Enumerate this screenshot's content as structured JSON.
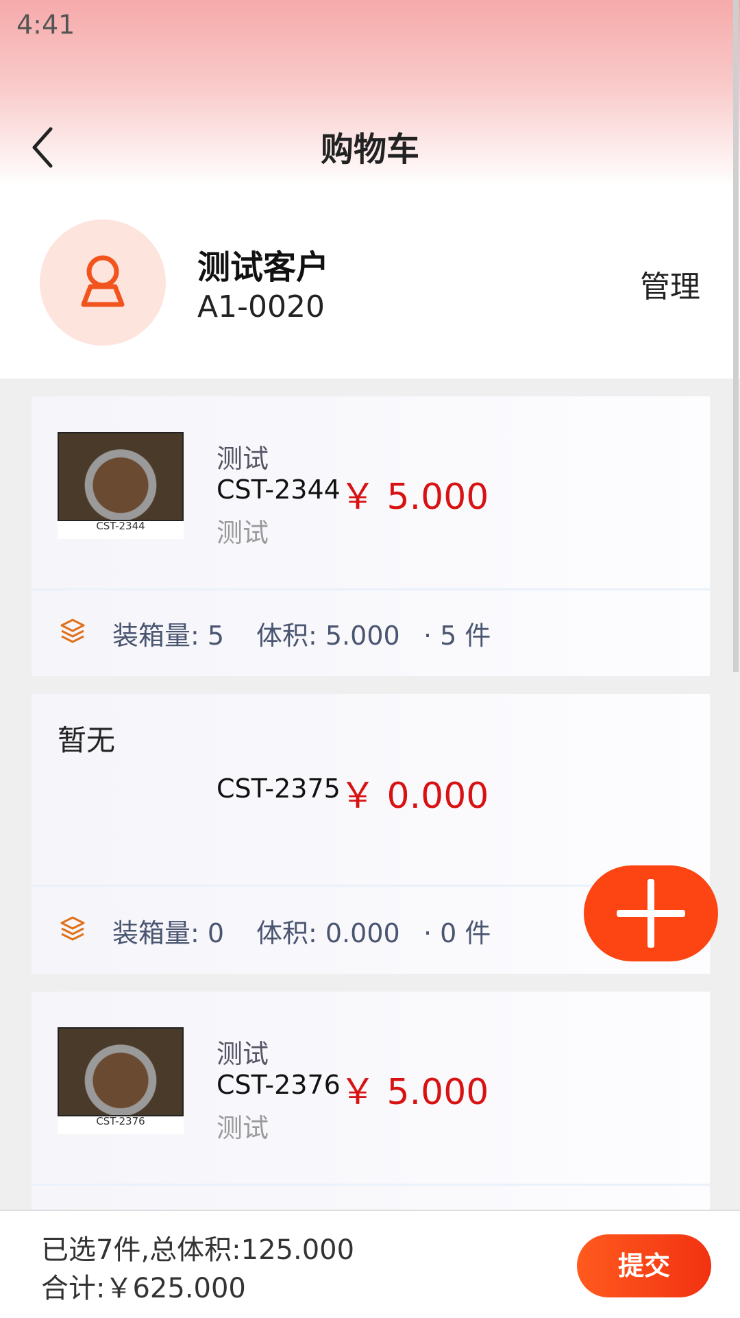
{
  "status_bar": {
    "time": "4:41"
  },
  "header": {
    "title": "购物车"
  },
  "customer": {
    "name": "测试客户",
    "code": "A1-0020",
    "manage_label": "管理"
  },
  "cart_items": [
    {
      "image_caption": "CST-2344",
      "name": "测试",
      "code": "CST-2344",
      "price": "￥ 5.000",
      "description": "测试",
      "box_qty": "装箱量: 5",
      "volume": "体积: 5.000",
      "count": "· 5 件"
    },
    {
      "no_image_label": "暂无",
      "code": "CST-2375",
      "price": "￥ 0.000",
      "box_qty": "装箱量: 0",
      "volume": "体积: 0.000",
      "count": "· 0 件"
    },
    {
      "image_caption": "CST-2376",
      "name": "测试",
      "code": "CST-2376",
      "price": "￥ 5.000",
      "description": "测试"
    }
  ],
  "footer": {
    "selected_summary": "已选7件,总体积:125.000",
    "total": "合计:￥625.000",
    "submit_label": "提交"
  },
  "colors": {
    "accent": "#fc4512",
    "price": "#d81212"
  },
  "icons": {
    "back": "chevron-left-icon",
    "avatar": "person-icon",
    "stats": "layers-icon",
    "fab": "plus-icon"
  }
}
